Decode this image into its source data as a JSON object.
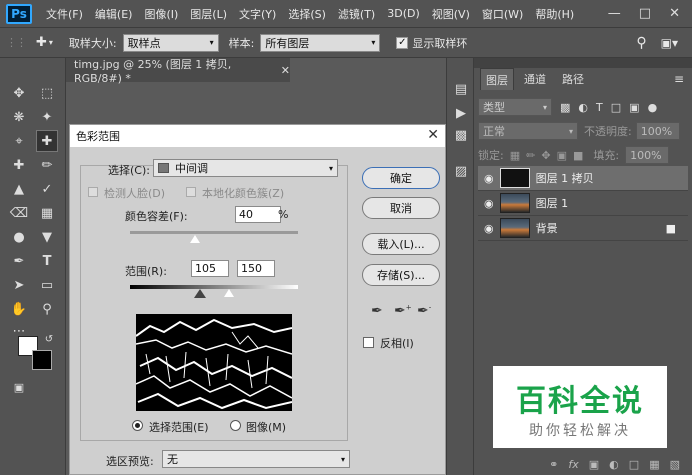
{
  "app": {
    "logo": "Ps"
  },
  "menubar": {
    "items": [
      "文件(F)",
      "编辑(E)",
      "图像(I)",
      "图层(L)",
      "文字(Y)",
      "选择(S)",
      "滤镜(T)",
      "3D(D)",
      "视图(V)",
      "窗口(W)",
      "帮助(H)"
    ]
  },
  "optbar": {
    "sample_size_label": "取样大小:",
    "sample_size_value": "取样点",
    "sample_label": "样本:",
    "sample_value": "所有图层",
    "show_ring_label": "显示取样环"
  },
  "doc": {
    "tab_title": "timg.jpg @ 25% (图层 1 拷贝, RGB/8#) *"
  },
  "layers_panel": {
    "tabs": [
      "图层",
      "通道",
      "路径"
    ],
    "filter_kind": "类型",
    "blend_mode": "正常",
    "opacity_label": "不透明度:",
    "opacity_value": "100%",
    "lock_label": "锁定:",
    "fill_label": "填充:",
    "fill_value": "100%",
    "layers": [
      {
        "name": "图层 1 拷贝",
        "selected": true,
        "locked": false
      },
      {
        "name": "图层 1",
        "selected": false,
        "locked": false
      },
      {
        "name": "背景",
        "selected": false,
        "locked": true
      }
    ]
  },
  "dialog": {
    "title": "色彩范围",
    "select_label": "选择(C):",
    "select_value": "中间调",
    "detect_faces_label": "检测人脸(D)",
    "localized_label": "本地化颜色簇(Z)",
    "fuzziness_label": "颜色容差(F):",
    "fuzziness_value": "40",
    "fuzziness_unit": "%",
    "range_label": "范围(R):",
    "range_low": "105",
    "range_high": "150",
    "radio_selection_label": "选择范围(E)",
    "radio_image_label": "图像(M)",
    "preview_label": "选区预览:",
    "preview_value": "无",
    "ok_label": "确定",
    "cancel_label": "取消",
    "load_label": "载入(L)...",
    "save_label": "存储(S)...",
    "invert_label": "反相(I)"
  },
  "watermark": {
    "title": "百科全说",
    "subtitle": "助你轻松解决",
    "title_color": "#1aa34a"
  }
}
